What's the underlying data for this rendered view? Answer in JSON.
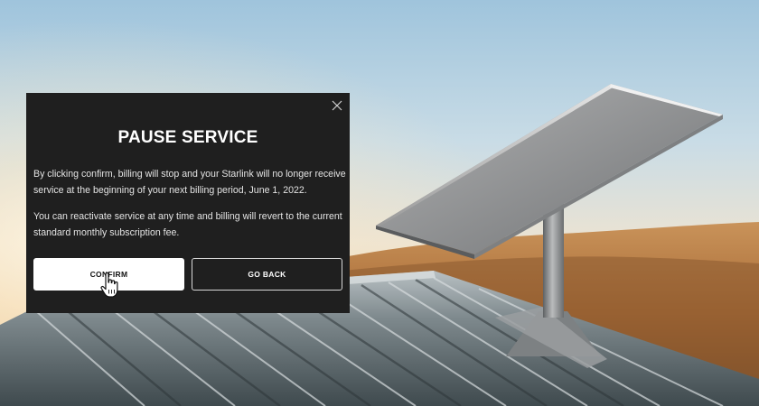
{
  "modal": {
    "title": "PAUSE SERVICE",
    "paragraph_1": "By clicking confirm, billing will stop and your Starlink will no longer receive service at the beginning of your next billing period, June 1, 2022.",
    "paragraph_2": "You can reactivate service at any time and billing will revert to the current standard monthly subscription fee.",
    "confirm_label": "CONFIRM",
    "back_label": "GO BACK",
    "close_icon": "close-icon"
  },
  "cursor_icon": "hand-pointer-icon",
  "colors": {
    "modal_bg": "#1f1f1f",
    "confirm_bg": "#ffffff",
    "text": "#ffffff"
  }
}
